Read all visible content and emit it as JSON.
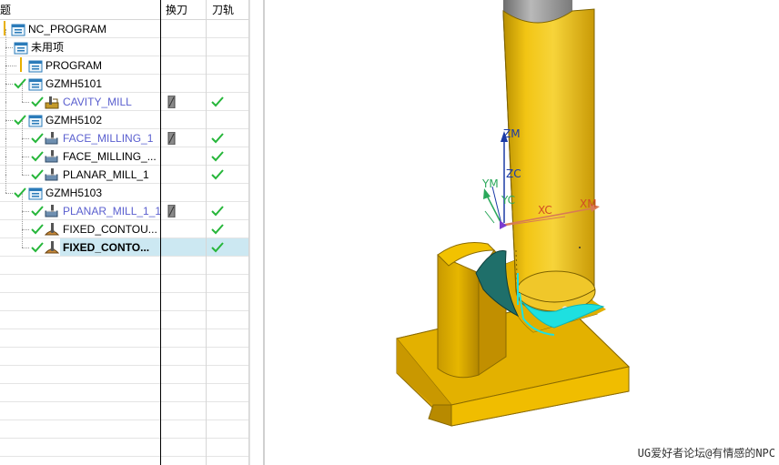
{
  "navigator": {
    "headers": {
      "name": "题",
      "tool_change": "换刀",
      "tool_path": "刀轨"
    },
    "rows": [
      {
        "label": "NC_PROGRAM",
        "type": "root",
        "status": "warning",
        "tool_change": false,
        "tool_path": false
      },
      {
        "label": "未用项",
        "type": "group",
        "status": "none",
        "tool_change": false,
        "tool_path": false
      },
      {
        "label": "PROGRAM",
        "type": "group",
        "status": "warning",
        "tool_change": false,
        "tool_path": false
      },
      {
        "label": "GZMH5101",
        "type": "group",
        "status": "ok",
        "tool_change": false,
        "tool_path": false
      },
      {
        "label": "CAVITY_MILL",
        "type": "operation",
        "status": "ok",
        "tool_change": true,
        "tool_path": true
      },
      {
        "label": "GZMH5102",
        "type": "group",
        "status": "ok",
        "tool_change": false,
        "tool_path": false
      },
      {
        "label": "FACE_MILLING_1",
        "type": "operation",
        "status": "ok",
        "tool_change": true,
        "tool_path": true
      },
      {
        "label": "FACE_MILLING_...",
        "type": "operation",
        "status": "ok",
        "tool_change": false,
        "tool_path": true
      },
      {
        "label": "PLANAR_MILL_1",
        "type": "operation",
        "status": "ok",
        "tool_change": false,
        "tool_path": true
      },
      {
        "label": "GZMH5103",
        "type": "group",
        "status": "ok",
        "tool_change": false,
        "tool_path": false
      },
      {
        "label": "PLANAR_MILL_1_1",
        "type": "operation",
        "status": "ok",
        "tool_change": true,
        "tool_path": true
      },
      {
        "label": "FIXED_CONTOU...",
        "type": "operation",
        "status": "ok",
        "tool_change": false,
        "tool_path": true
      },
      {
        "label": "FIXED_CONTO...",
        "type": "operation",
        "status": "ok",
        "tool_change": false,
        "tool_path": true,
        "selected": true
      }
    ]
  },
  "viewport": {
    "axes": {
      "zm": "ZM",
      "zc": "ZC",
      "ym": "YM",
      "yc": "YC",
      "xc": "XC",
      "xm": "XM"
    },
    "watermark": "UG爱好者论坛@有情感的NPC",
    "colors": {
      "part": "#e8b800",
      "tool": "#e6c32a",
      "toolpath": "#1ee0e0",
      "cut": "#1f6f6a"
    }
  }
}
